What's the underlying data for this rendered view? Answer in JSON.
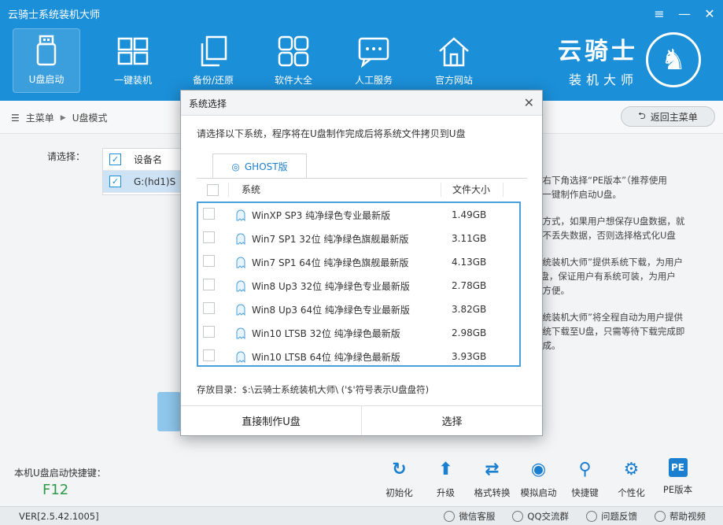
{
  "window": {
    "title": "云骑士系统装机大师",
    "controls": [
      "≡",
      "—",
      "✕"
    ]
  },
  "nav": [
    {
      "label": "U盘启动",
      "icon": "usb-icon",
      "active": true
    },
    {
      "label": "一键装机",
      "icon": "windows-icon"
    },
    {
      "label": "备份/还原",
      "icon": "copy-icon"
    },
    {
      "label": "软件大全",
      "icon": "apps-icon"
    },
    {
      "label": "人工服务",
      "icon": "chat-icon"
    },
    {
      "label": "官方网站",
      "icon": "home-icon"
    }
  ],
  "brand": {
    "name": "云骑士",
    "sub": "装机大师"
  },
  "breadcrumb": {
    "menu_icon": "☰",
    "root": "主菜单",
    "separator": "▶",
    "current": "U盘模式"
  },
  "back_button": {
    "label": "返回主菜单",
    "icon": "back-arrow-icon"
  },
  "background": {
    "select_label": "请选择：",
    "device_header": "设备名",
    "device_row": "G:(hd1)S",
    "side_text": [
      "，右下角选择“PE版本”（推荐使用\n击一键制作启动U盘。",
      "化方式，如果用户想保存U盘数据，就\n且不丢失数据，否则选择格式化U盘",
      "系统装机大师”提供系统下载，为用户\nU盘，保证用户有系统可装，为用户\n来方便。",
      "系统装机大师”将全程自动为用户提供\n系统下载至U盘，只需等待下载完成即\n完成。"
    ]
  },
  "hotkey": {
    "label": "本机U盘启动快捷键：",
    "value": "F12"
  },
  "tools": [
    {
      "label": "初始化",
      "glyph": "↻"
    },
    {
      "label": "升级",
      "glyph": "⬆"
    },
    {
      "label": "格式转换",
      "glyph": "⇄"
    },
    {
      "label": "模拟启动",
      "glyph": "◉"
    },
    {
      "label": "快捷键",
      "glyph": "⚲"
    },
    {
      "label": "个性化",
      "glyph": "⚙"
    },
    {
      "label": "PE版本",
      "glyph": "PE"
    }
  ],
  "status": {
    "version": "VER[2.5.42.1005]",
    "links": [
      "微信客服",
      "QQ交流群",
      "问题反馈",
      "帮助视频"
    ]
  },
  "dialog": {
    "title": "系统选择",
    "close": "✕",
    "intro": "请选择以下系统，程序将在U盘制作完成后将系统文件拷贝到U盘",
    "tab": "GHOST版",
    "columns": {
      "system": "系统",
      "size": "文件大小"
    },
    "rows": [
      {
        "name": "WinXP SP3 纯净绿色专业最新版",
        "size": "1.49GB"
      },
      {
        "name": "Win7 SP1 32位 纯净绿色旗舰最新版",
        "size": "3.11GB"
      },
      {
        "name": "Win7 SP1 64位 纯净绿色旗舰最新版",
        "size": "4.13GB"
      },
      {
        "name": "Win8 Up3 32位 纯净绿色专业最新版",
        "size": "2.78GB"
      },
      {
        "name": "Win8 Up3 64位 纯净绿色专业最新版",
        "size": "3.82GB"
      },
      {
        "name": "Win10 LTSB 32位 纯净绿色最新版",
        "size": "2.98GB"
      },
      {
        "name": "Win10 LTSB 64位 纯净绿色最新版",
        "size": "3.93GB"
      }
    ],
    "storage": "存放目录：$:\\云骑士系统装机大师\\ ('$'符号表示U盘盘符)",
    "buttons": {
      "make": "直接制作U盘",
      "select": "选择"
    }
  },
  "colors": {
    "accent": "#1b8fd8",
    "list_border": "#4aa0dc",
    "hotkey": "#2e9a47"
  }
}
